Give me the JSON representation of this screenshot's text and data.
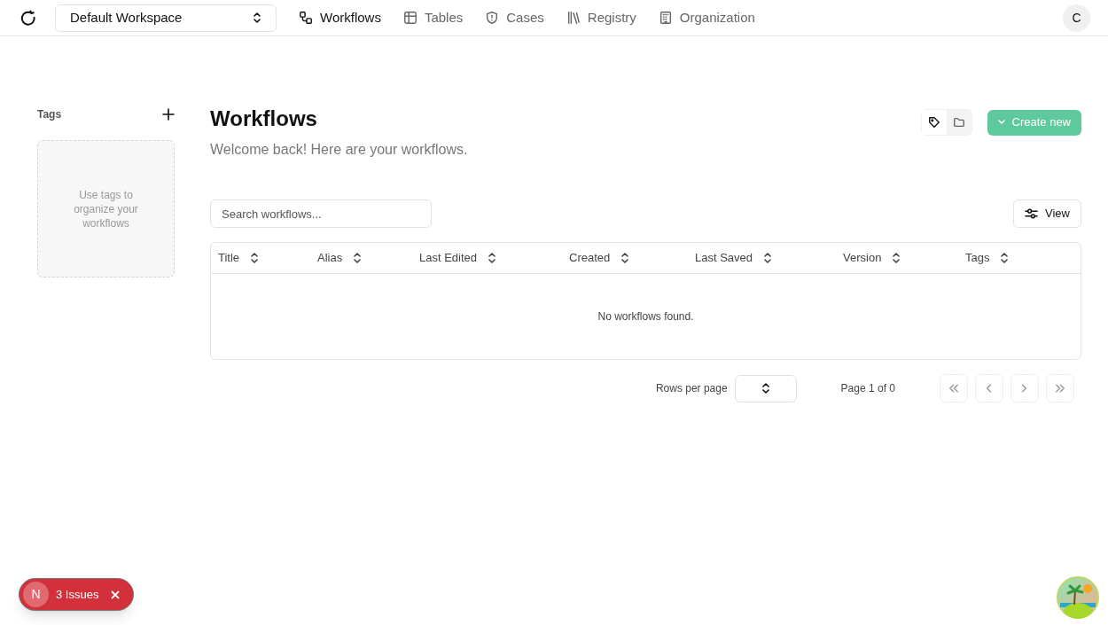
{
  "topbar": {
    "workspace": "Default Workspace",
    "nav": [
      {
        "label": "Workflows",
        "kind": "workflows",
        "selected": true
      },
      {
        "label": "Tables",
        "kind": "tables",
        "selected": false
      },
      {
        "label": "Cases",
        "kind": "cases",
        "selected": false
      },
      {
        "label": "Registry",
        "kind": "registry",
        "selected": false
      },
      {
        "label": "Organization",
        "kind": "organization",
        "selected": false
      }
    ],
    "avatar": "C"
  },
  "sidebar": {
    "title": "Tags",
    "empty_text": "Use tags to organize your workflows"
  },
  "view_toggle": [
    {
      "kind": "tag",
      "selected": false
    },
    {
      "kind": "folder",
      "selected": true
    }
  ],
  "page": {
    "title": "Workflows",
    "subtitle": "Welcome back! Here are your workflows.",
    "create_button": "Create new",
    "search": {
      "placeholder": "Search workflows..."
    },
    "view_button": "View"
  },
  "table": {
    "columns": [
      "Title",
      "Alias",
      "Last Edited",
      "Created",
      "Last Saved",
      "Version",
      "Tags"
    ],
    "empty_text": "No workflows found."
  },
  "pagination": {
    "rows_label": "Rows per page",
    "page_text": "Page 1 of 0"
  },
  "issues_badge": {
    "letter": "N",
    "label": "3 Issues"
  }
}
